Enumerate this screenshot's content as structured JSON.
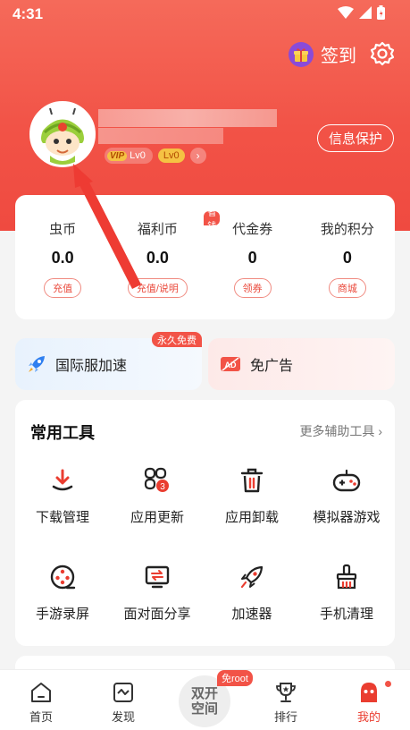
{
  "status_bar": {
    "time": "4:31"
  },
  "header": {
    "checkin_label": "签到",
    "privacy_button": "信息保护",
    "badges": {
      "vip": "VIP",
      "vip_level": "Lv0",
      "level": "Lv0"
    }
  },
  "wallet": {
    "items": [
      {
        "label": "虫币",
        "value": "0.0",
        "button": "充值"
      },
      {
        "label": "福利币",
        "value": "0.0",
        "button": "充值/说明",
        "tag": "省钱"
      },
      {
        "label": "代金券",
        "value": "0",
        "button": "领券"
      },
      {
        "label": "我的积分",
        "value": "0",
        "button": "商城"
      }
    ]
  },
  "promos": {
    "left": {
      "label": "国际服加速",
      "tag": "永久免费"
    },
    "right": {
      "label": "免广告"
    }
  },
  "tools": {
    "title": "常用工具",
    "more": "更多辅助工具",
    "items": [
      {
        "label": "下载管理",
        "icon": "download-icon"
      },
      {
        "label": "应用更新",
        "icon": "app-update-icon",
        "count": "3"
      },
      {
        "label": "应用卸载",
        "icon": "trash-icon"
      },
      {
        "label": "模拟器游戏",
        "icon": "gamepad-icon"
      },
      {
        "label": "手游录屏",
        "icon": "film-reel-icon"
      },
      {
        "label": "面对面分享",
        "icon": "face-share-icon"
      },
      {
        "label": "加速器",
        "icon": "rocket-icon"
      },
      {
        "label": "手机清理",
        "icon": "brush-icon"
      }
    ]
  },
  "navbar": {
    "items": [
      {
        "label": "首页",
        "icon": "home-icon"
      },
      {
        "label": "发现",
        "icon": "discover-icon"
      },
      {
        "label": "排行",
        "icon": "trophy-icon"
      },
      {
        "label": "我的",
        "icon": "profile-icon"
      }
    ],
    "center_label": "双开空间",
    "center_line1": "双开",
    "center_line2": "空间",
    "center_tag": "免root"
  },
  "colors": {
    "accent": "#f25347",
    "active_nav": "#ea3d30",
    "blue_icon": "#2f7ff0"
  }
}
